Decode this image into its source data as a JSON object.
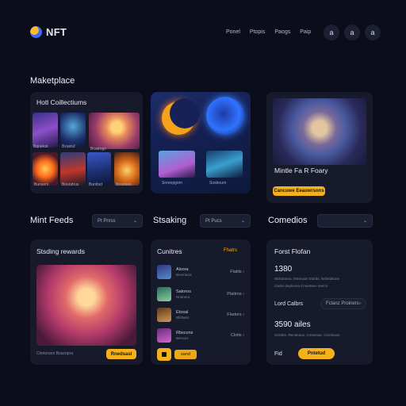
{
  "header": {
    "brand": "NFT",
    "nav": [
      "Ponel",
      "Ptopis",
      "Paogs",
      "Paip"
    ],
    "buttons": [
      "a",
      "a",
      "a"
    ]
  },
  "marketplace": {
    "title": "Maketplace",
    "collections": {
      "title": "Hotl Coillectiums",
      "labels": [
        "Bqrarkst",
        "Bzastuf",
        "Bcatrogs",
        "Bunsers",
        "Bouodrus",
        "Bunttsd",
        "Bronfsos"
      ]
    },
    "featured": {
      "labels": [
        "Snorepgom",
        "Sosbourn"
      ]
    },
    "hero": {
      "title": "Mintle Fa R Foary",
      "button": "Cancuwe Eeauwrsons"
    }
  },
  "rows": {
    "nft_feeds": {
      "title": "Mint Feeds",
      "select": "Pt Pnrss"
    },
    "staking": {
      "title": "Stsaking",
      "select": "Pt Pucs"
    },
    "comedios": {
      "title": "Comedios",
      "select": ""
    }
  },
  "staking_rewards": {
    "title": "Stsding rewards",
    "caption": "Clortoroon Boacopra",
    "button": "Rnedsasl"
  },
  "creators": {
    "title": "Cunitres",
    "link": "Fhatrs",
    "items": [
      {
        "name": "Alsora",
        "sub": "Bnemtura",
        "value": "Flatils"
      },
      {
        "name": "Satoros",
        "sub": "Nnanera",
        "value": "Platirns"
      },
      {
        "name": "Etosal",
        "sub": "Bfeltaen",
        "value": "Fladors"
      },
      {
        "name": "Rbscons",
        "sub": "Beroors",
        "value": "Cloits"
      }
    ],
    "footer_button": "sand"
  },
  "portfolio": {
    "title": "Forst Flofan",
    "value1": "1380",
    "text1": "Nbrtaranra, Mmecam Elorbs, Nsfeabtone",
    "text2": "Lbebs deplnosa Cmestneu mercn",
    "label2": "Lord Calbrs",
    "select2": "Fclanz Proiners",
    "value2": "3590 ailes",
    "text3": "Gnnbre, Renotutos, Cmeenas, Cmetsaos",
    "footer_label": "Fid",
    "footer_button": "Pntetud"
  },
  "colors": {
    "background": "#0b0d1a",
    "card": "#161a2b",
    "accent": "#f5b11a"
  }
}
